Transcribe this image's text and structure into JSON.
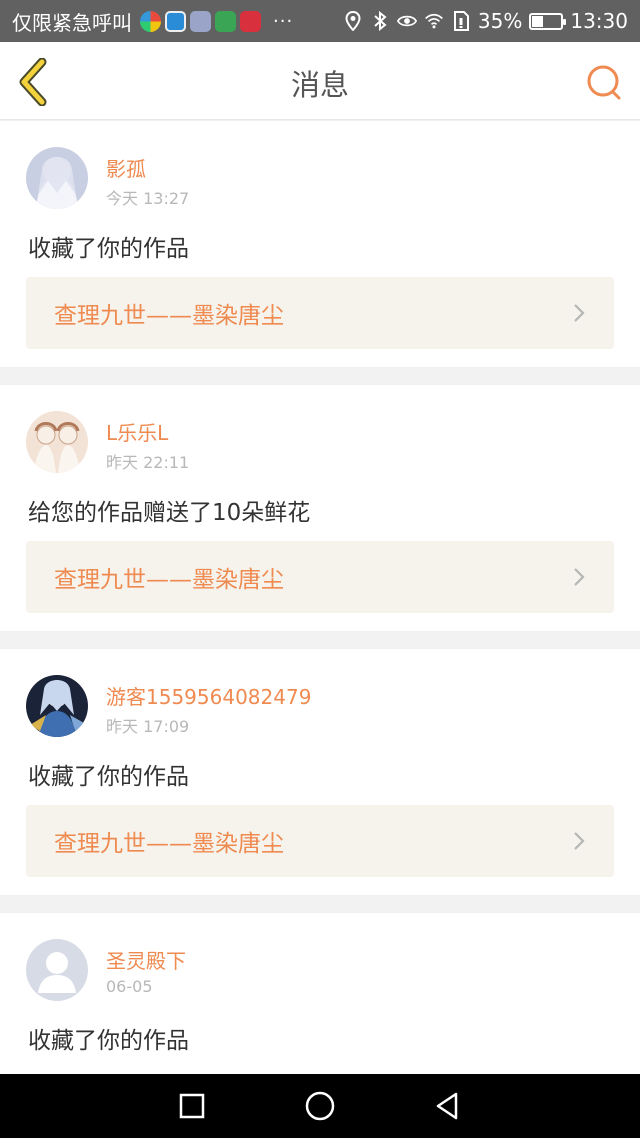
{
  "status_bar": {
    "carrier_text": "仅限紧急呼叫",
    "more": "···",
    "battery_percent": "35%",
    "battery_level": 0.35,
    "time": "13:30",
    "app_icons": [
      "photos-app-icon",
      "browser-app-icon",
      "security-app-icon",
      "lock-app-icon",
      "news-app-icon"
    ],
    "status_icons": [
      "location-icon",
      "bluetooth-icon",
      "eye-icon",
      "wifi-icon",
      "sim-icon"
    ]
  },
  "header": {
    "title": "消息",
    "back_icon": "back-chevron-icon",
    "search_icon": "search-icon"
  },
  "colors": {
    "accent": "#ef8a50",
    "back_icon_fill": "#f4d23c",
    "card_link_bg": "#f5f3ec",
    "status_bar_bg": "#616161"
  },
  "messages": [
    {
      "username": "影孤",
      "timestamp": "今天 13:27",
      "text": "收藏了你的作品",
      "work_title": "查理九世——墨染唐尘",
      "avatar": "anime-avatar-white"
    },
    {
      "username": "L乐乐L",
      "timestamp": "昨天 22:11",
      "text": "给您的作品赠送了10朵鲜花",
      "work_title": "查理九世——墨染唐尘",
      "avatar": "anime-avatar-beige"
    },
    {
      "username": "游客1559564082479",
      "timestamp": "昨天 17:09",
      "text": "收藏了你的作品",
      "work_title": "查理九世——墨染唐尘",
      "avatar": "anime-avatar-dark"
    },
    {
      "username": "圣灵殿下",
      "timestamp": "06-05",
      "text": "收藏了你的作品",
      "avatar": "default-avatar"
    }
  ],
  "nav_bar": {
    "buttons": [
      "recents-square-icon",
      "home-circle-icon",
      "back-triangle-icon"
    ]
  }
}
